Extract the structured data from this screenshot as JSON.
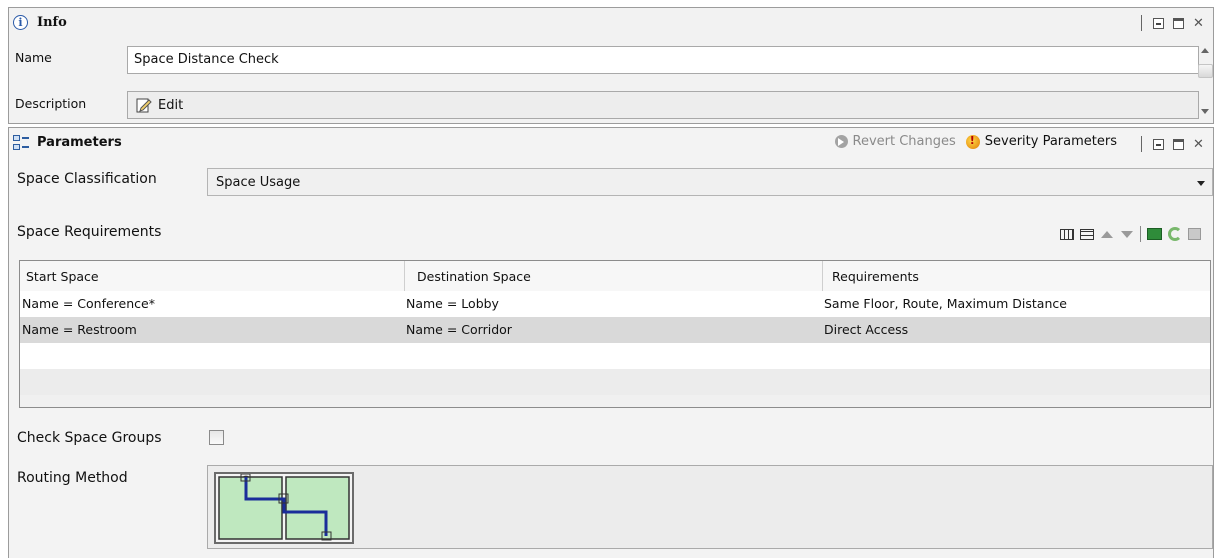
{
  "info_panel": {
    "title": "Info",
    "name_label": "Name",
    "name_value": "Space Distance Check",
    "description_label": "Description",
    "description_button": "Edit"
  },
  "params_panel": {
    "title": "Parameters",
    "revert_label": "Revert Changes",
    "severity_label": "Severity Parameters",
    "space_classification_label": "Space Classification",
    "space_classification_value": "Space Usage",
    "space_requirements_label": "Space Requirements",
    "table": {
      "columns": [
        "Start Space",
        "Destination Space",
        "Requirements"
      ],
      "rows": [
        [
          "Name = Conference*",
          "Name = Lobby",
          "Same Floor, Route, Maximum Distance"
        ],
        [
          "Name = Restroom",
          "Name = Corridor",
          "Direct Access"
        ]
      ]
    },
    "check_space_groups_label": "Check Space Groups",
    "check_space_groups_checked": false,
    "routing_method_label": "Routing Method"
  },
  "colors": {
    "selected_row": "#d9d9d9",
    "route_line": "#1a2d9a",
    "room_fill": "#bfe8bf"
  }
}
